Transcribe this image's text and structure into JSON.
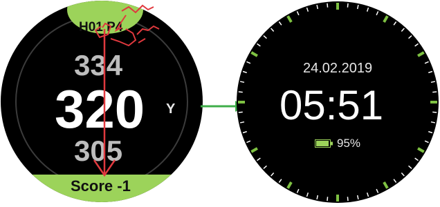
{
  "left_watch": {
    "hole": "H01 P4",
    "distance_back": "334",
    "distance_center": "320",
    "distance_unit": "Y",
    "distance_front": "305",
    "score": "Score -1"
  },
  "right_watch": {
    "date": "24.02.2019",
    "time": "05:51",
    "battery": "95%",
    "battery_level": 0.95
  },
  "colors": {
    "green_accent": "#9cd35a",
    "annotation_red": "#e0393e",
    "arrow_green": "#3fae49",
    "tick_green": "#7ec142",
    "tick_white": "#ffffff"
  },
  "icons": {
    "battery": "battery-icon",
    "connector": "arrow-right-icon"
  }
}
